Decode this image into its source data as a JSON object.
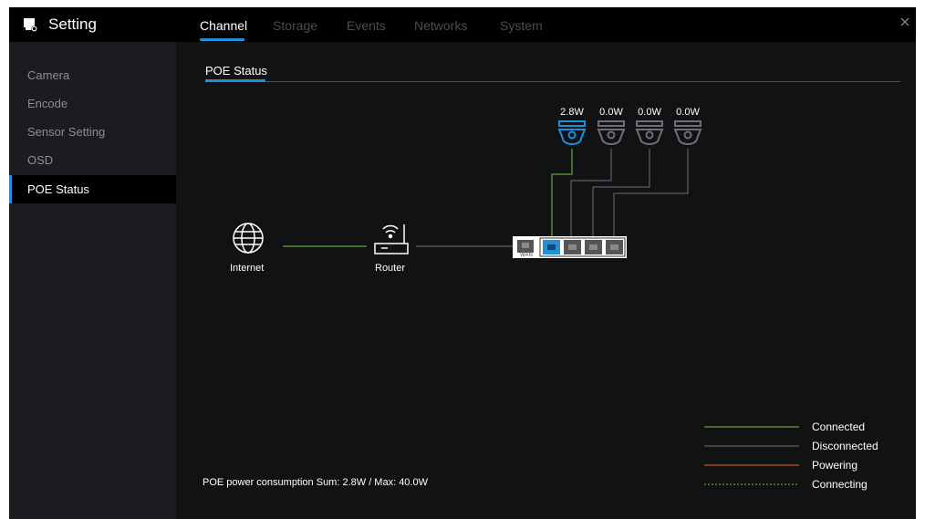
{
  "app": {
    "title": "Setting"
  },
  "tabs": [
    {
      "label": "Channel",
      "active": true
    },
    {
      "label": "Storage",
      "active": false
    },
    {
      "label": "Events",
      "active": false
    },
    {
      "label": "Networks",
      "active": false
    },
    {
      "label": "System",
      "active": false
    }
  ],
  "sidebar": {
    "items": [
      {
        "label": "Camera"
      },
      {
        "label": "Encode"
      },
      {
        "label": "Sensor Setting"
      },
      {
        "label": "OSD"
      },
      {
        "label": "POE Status",
        "active": true
      }
    ]
  },
  "section": {
    "subtab": "POE Status"
  },
  "diagram": {
    "internet_label": "Internet",
    "router_label": "Router",
    "wan_label": "WAN",
    "cameras": [
      {
        "watt": "2.8W",
        "status": "connected"
      },
      {
        "watt": "0.0W",
        "status": "disconnected"
      },
      {
        "watt": "0.0W",
        "status": "disconnected"
      },
      {
        "watt": "0.0W",
        "status": "disconnected"
      }
    ]
  },
  "legend": {
    "items": [
      {
        "label": "Connected",
        "color": "#7ac143",
        "style": "solid"
      },
      {
        "label": "Disconnected",
        "color": "#6e7075",
        "style": "solid"
      },
      {
        "label": "Powering",
        "color": "#e8622a",
        "style": "solid"
      },
      {
        "label": "Connecting",
        "color": "#7ac143",
        "style": "dashed"
      }
    ]
  },
  "summary": "POE power consumption Sum: 2.8W / Max: 40.0W",
  "colors": {
    "accent": "#1e8fd8",
    "connected": "#7ac143",
    "disconnected": "#6e7075"
  },
  "icons": [
    "settings-monitor-icon",
    "close-icon",
    "globe-icon",
    "router-icon",
    "switch-icon",
    "dome-camera-icon"
  ]
}
